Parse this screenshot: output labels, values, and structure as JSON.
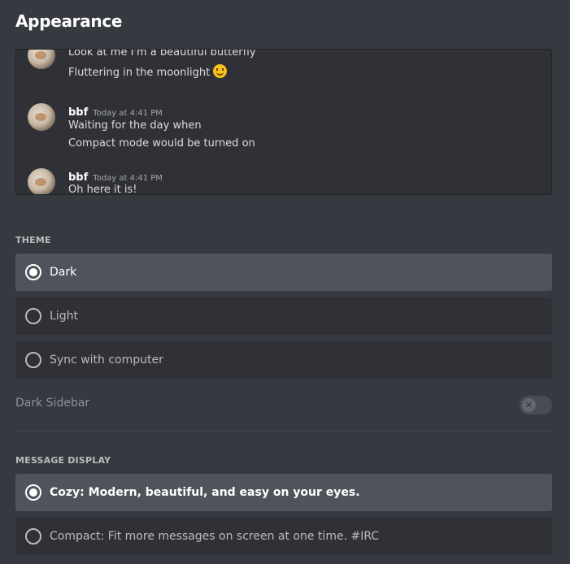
{
  "page": {
    "title": "Appearance"
  },
  "preview": {
    "messages": [
      {
        "author": "",
        "timestamp": "",
        "lines": [
          "Look at me I'm a beautiful butterfly",
          "Fluttering in the moonlight"
        ],
        "trailing_emoji": "slightly-smiling-face"
      },
      {
        "author": "bbf",
        "timestamp": "Today at 4:41 PM",
        "lines": [
          "Waiting for the day when",
          "Compact mode would be turned on"
        ]
      },
      {
        "author": "bbf",
        "timestamp": "Today at 4:41 PM",
        "lines": [
          "Oh here it is!"
        ]
      }
    ]
  },
  "theme": {
    "heading": "THEME",
    "options": [
      {
        "label": "Dark",
        "selected": true
      },
      {
        "label": "Light",
        "selected": false
      },
      {
        "label": "Sync with computer",
        "selected": false
      }
    ]
  },
  "dark_sidebar": {
    "label": "Dark Sidebar",
    "enabled": false,
    "toggle_icon": "x-icon"
  },
  "message_display": {
    "heading": "MESSAGE DISPLAY",
    "options": [
      {
        "label": "Cozy: Modern, beautiful, and easy on your eyes.",
        "selected": true
      },
      {
        "label": "Compact: Fit more messages on screen at one time. #IRC",
        "selected": false
      }
    ]
  },
  "colors": {
    "background": "#36393f",
    "panel": "#2f3136",
    "selected_option": "#4f545c",
    "text_primary": "#ffffff",
    "text_muted": "#b9bbbe"
  }
}
